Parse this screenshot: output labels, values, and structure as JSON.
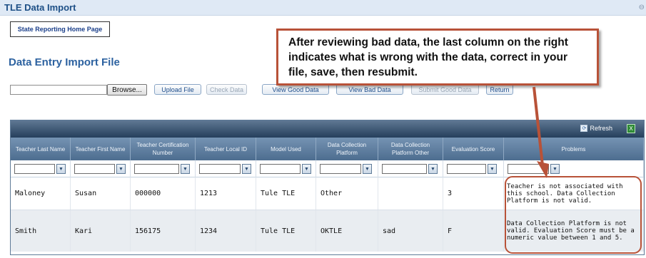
{
  "title": "TLE Data Import",
  "home_button": "State Reporting Home Page",
  "subheading": "Data Entry Import File",
  "toolbar": {
    "browse": "Browse...",
    "upload": "Upload File",
    "check": "Check Data",
    "view_good": "View Good Data",
    "view_bad": "View Bad Data",
    "submit_good": "Submit Good Data",
    "return": "Return"
  },
  "callout": "After reviewing bad data, the last column on the right indicates what is wrong with the data, correct in your file, save, then resubmit.",
  "grid": {
    "refresh": "Refresh",
    "columns": [
      "Teacher Last Name",
      "Teacher First Name",
      "Teacher Certification Number",
      "Teacher Local ID",
      "Model Used",
      "Data Collection Platform",
      "Data Collection Platform Other",
      "Evaluation Score",
      "Problems"
    ],
    "rows": [
      [
        "Maloney",
        "Susan",
        "000000",
        "1213",
        "Tule TLE",
        "Other",
        "",
        "3",
        "Teacher is not associated with this school. Data Collection Platform is not valid."
      ],
      [
        "Smith",
        "Kari",
        "156175",
        "1234",
        "Tule TLE",
        "OKTLE",
        "sad",
        "F",
        "Data Collection Platform is not valid. Evaluation Score must be a numeric value between 1 and 5."
      ]
    ]
  },
  "colors": {
    "callout_border": "#b85238",
    "header_bar": "#253f5c",
    "title_text": "#1d4f86"
  }
}
